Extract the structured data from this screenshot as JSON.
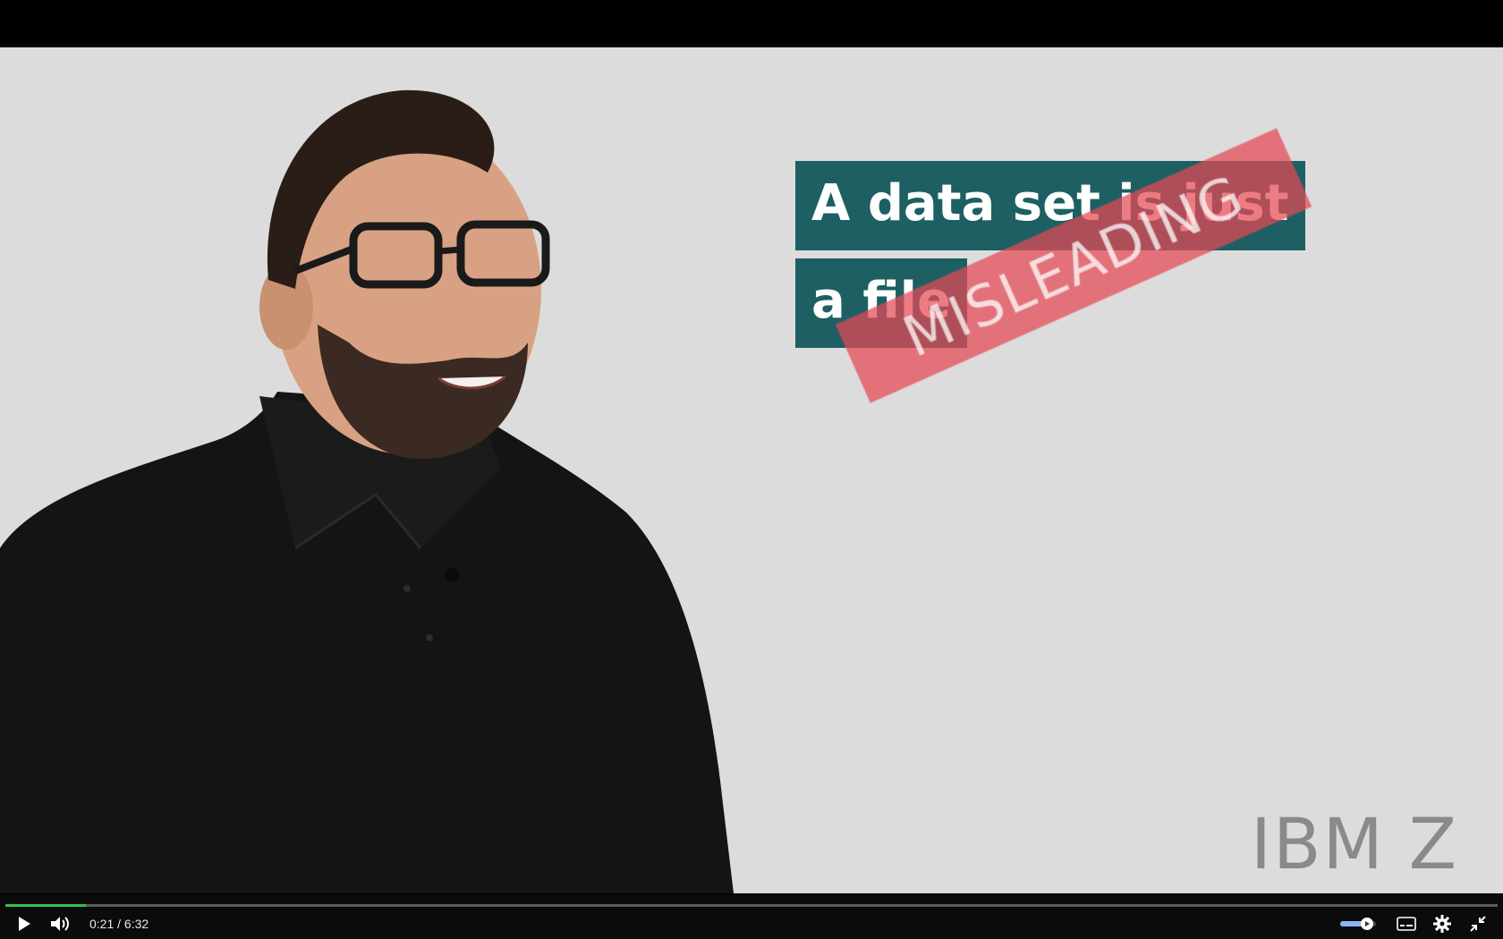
{
  "video": {
    "title_line1": "A data set is just",
    "title_line2": "a file",
    "stamp_text": "MISLEADING",
    "logo_text": "IBM Z",
    "background_color": "#dcdcdc",
    "title_bg_color": "#1d5f62",
    "stamp_color": "#e54854"
  },
  "controls": {
    "play_icon": "play-icon",
    "volume_icon": "volume-icon",
    "current_time": "0:21",
    "separator": " / ",
    "duration": "6:32",
    "progress_fraction": 0.054,
    "progress_color": "#32c24d",
    "volume_level": 0.75,
    "captions_icon": "captions-icon",
    "settings_icon": "gear-icon",
    "exit_fullscreen_icon": "exit-fullscreen-icon"
  }
}
